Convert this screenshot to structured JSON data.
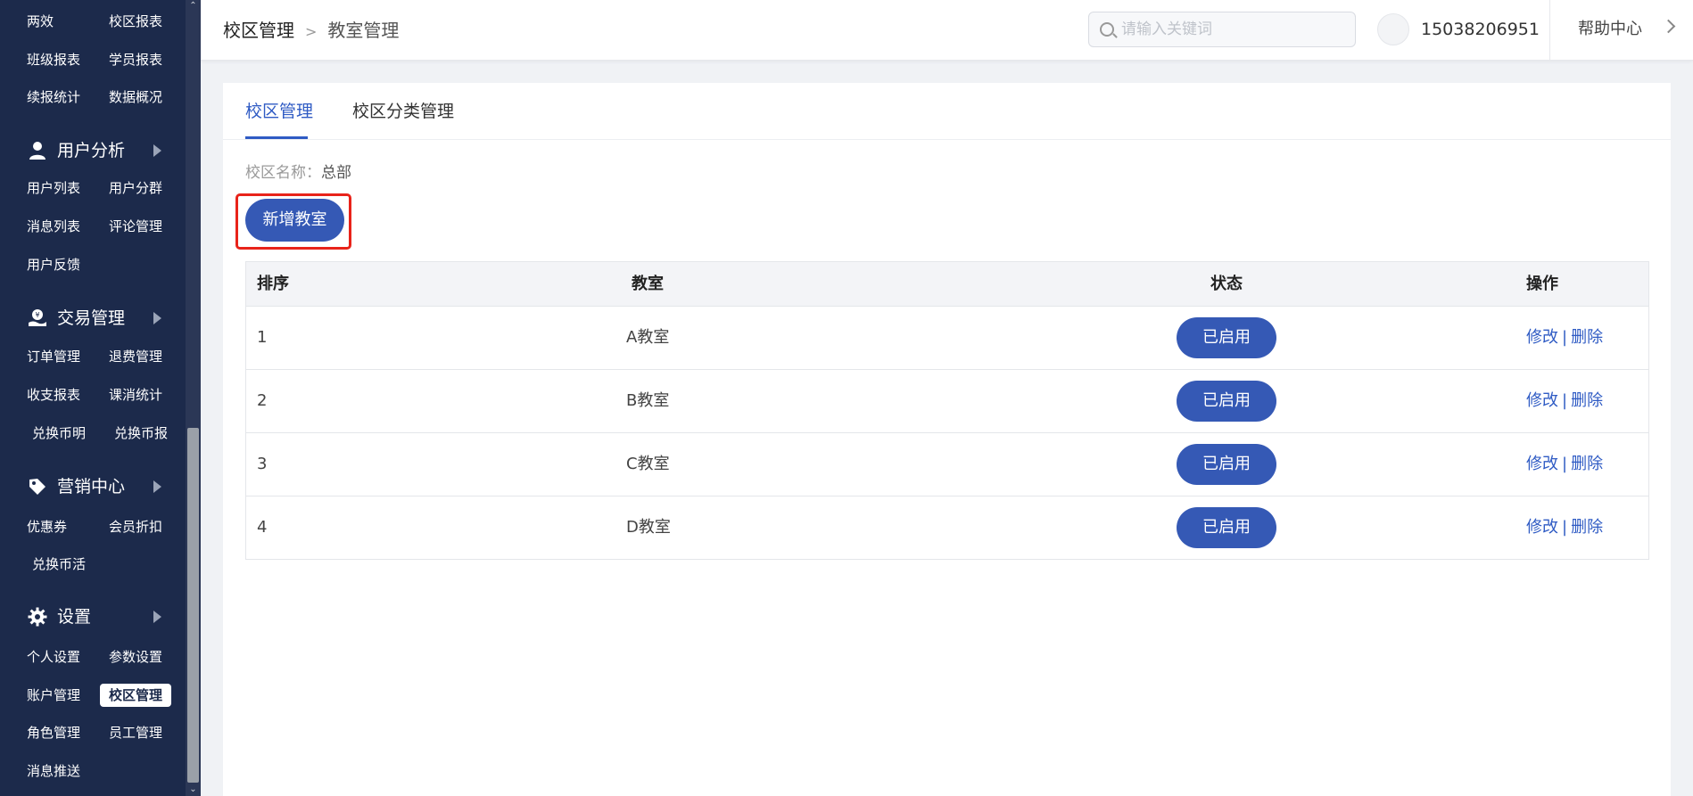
{
  "sidebar": {
    "rows": [
      [
        "两效",
        "校区报表"
      ],
      [
        "班级报表",
        "学员报表"
      ],
      [
        "续报统计",
        "数据概况"
      ]
    ],
    "groups": {
      "user_analysis": {
        "label": "用户分析",
        "icon": "user-icon",
        "rows": [
          [
            "用户列表",
            "用户分群"
          ],
          [
            "消息列表",
            "评论管理"
          ],
          [
            "用户反馈"
          ]
        ]
      },
      "trade": {
        "label": "交易管理",
        "icon": "money-hand-icon",
        "rows": [
          [
            "订单管理",
            "退费管理"
          ],
          [
            "收支报表",
            "课消统计"
          ],
          [
            "兑换币明",
            "兑换币报"
          ]
        ]
      },
      "marketing": {
        "label": "营销中心",
        "icon": "tag-icon",
        "rows": [
          [
            "优惠券",
            "会员折扣"
          ],
          [
            "兑换币活"
          ]
        ]
      },
      "settings": {
        "label": "设置",
        "icon": "gear-icon",
        "rows": [
          [
            "个人设置",
            "参数设置"
          ],
          [
            "账户管理",
            "校区管理"
          ],
          [
            "角色管理",
            "员工管理"
          ],
          [
            "消息推送"
          ]
        ]
      }
    }
  },
  "header": {
    "breadcrumb": [
      "校区管理",
      "教室管理"
    ],
    "search_placeholder": "请输入关键词",
    "phone": "15038206951",
    "help": "帮助中心"
  },
  "main": {
    "tabs": [
      "校区管理",
      "校区分类管理"
    ],
    "campus_label": "校区名称：",
    "campus_value": "总部",
    "add_button": "新增教室",
    "table": {
      "columns": [
        "排序",
        "教室",
        "状态",
        "操作"
      ],
      "rows": [
        {
          "order": "1",
          "room": "A教室",
          "status": "已启用"
        },
        {
          "order": "2",
          "room": "B教室",
          "status": "已启用"
        },
        {
          "order": "3",
          "room": "C教室",
          "status": "已启用"
        },
        {
          "order": "4",
          "room": "D教室",
          "status": "已启用"
        }
      ],
      "edit_label": "修改",
      "op_sep": "|",
      "delete_label": "删除"
    }
  },
  "colors": {
    "sidebar_bg": "#1c2a4b",
    "primary": "#3559b5",
    "link": "#2f5bc4",
    "highlight": "#e8231a"
  }
}
